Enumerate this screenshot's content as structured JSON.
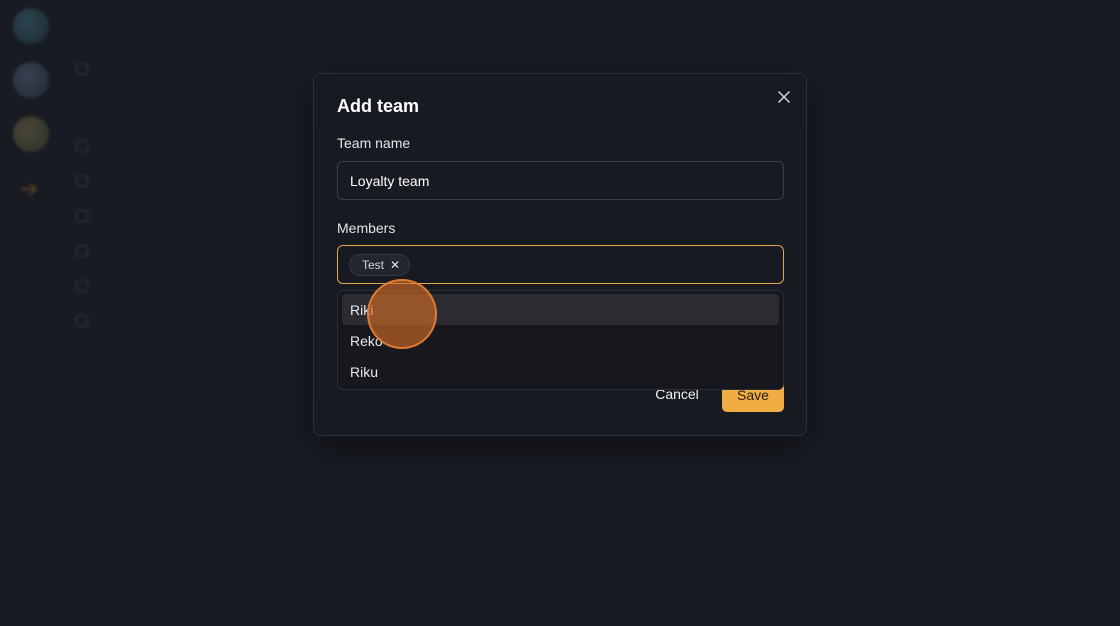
{
  "dialog": {
    "title": "Add team",
    "team_name_label": "Team name",
    "team_name_value": "Loyalty team",
    "members_label": "Members",
    "selected_members": [
      "Test"
    ],
    "member_options": [
      "Riki",
      "Reko",
      "Riku"
    ],
    "hovered_option_index": 0,
    "cancel_label": "Cancel",
    "save_label": "Save"
  },
  "icons": {
    "close": "close-icon",
    "chip_remove": "x-icon"
  },
  "colors": {
    "accent": "#f1ad43",
    "focus_border": "#e7a64c",
    "background": "#181b22",
    "dialog_bg": "#171a20"
  }
}
